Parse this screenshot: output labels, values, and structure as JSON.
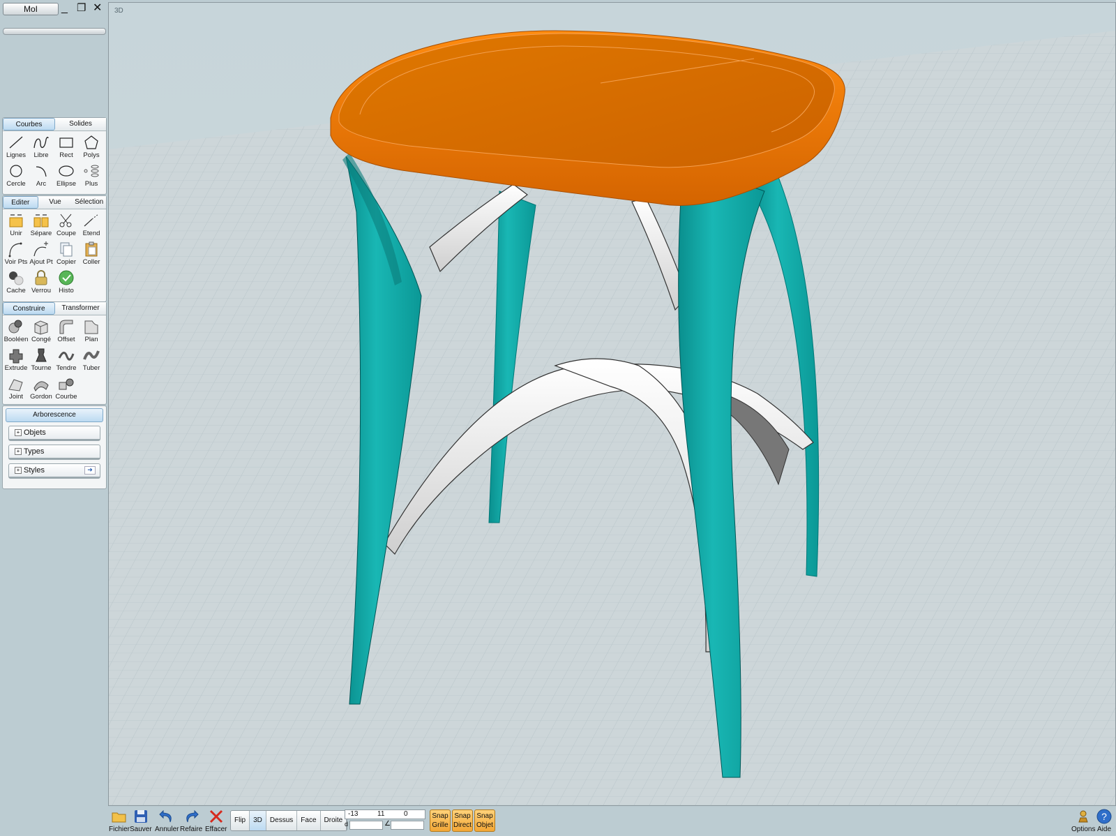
{
  "titlebar": {
    "app_button": "MoI",
    "minimize": "_",
    "restore": "❐",
    "close": "✕"
  },
  "panel_curves": {
    "tabs": [
      "Courbes",
      "Solides"
    ],
    "tools": [
      "Lignes",
      "Libre",
      "Rect",
      "Polys",
      "Cercle",
      "Arc",
      "Ellipse",
      "Plus"
    ]
  },
  "panel_edit": {
    "tabs": [
      "Editer",
      "Vue",
      "Sélection"
    ],
    "tools": [
      "Unir",
      "Sépare",
      "Coupe",
      "Etend",
      "Voir Pts",
      "Ajout Pt",
      "Copier",
      "Coller",
      "Cache",
      "Verrou",
      "Histo"
    ]
  },
  "panel_construct": {
    "tabs": [
      "Construire",
      "Transformer"
    ],
    "tools": [
      "Booléen",
      "Congé",
      "Offset",
      "Plan",
      "Extrude",
      "Tourne",
      "Tendre",
      "Tuber",
      "Joint",
      "Gordon",
      "Courbe"
    ]
  },
  "tree": {
    "header": "Arborescence",
    "items": [
      "Objets",
      "Types",
      "Styles"
    ]
  },
  "viewport": {
    "label": "3D"
  },
  "bottombar": {
    "file": "Fichier",
    "save": "Sauver",
    "undo": "Annuler",
    "redo": "Refaire",
    "delete": "Effacer",
    "views": [
      "Flip",
      "3D",
      "Dessus",
      "Face",
      "Droite"
    ],
    "coords": {
      "x": "-13",
      "y": "11",
      "z": "0",
      "d_label": "d",
      "angle_label": "∠"
    },
    "snaps": [
      [
        "Snap",
        "Grille"
      ],
      [
        "Snap",
        "Direct"
      ],
      [
        "Snap",
        "Objet"
      ]
    ],
    "options": "Options",
    "help": "Aide"
  },
  "colors": {
    "seat": "#d86a00",
    "legs": "#10aaa8",
    "rails": "#f4f4f4",
    "tab_active": "#bcdaf1",
    "snap": "#f3a736"
  }
}
